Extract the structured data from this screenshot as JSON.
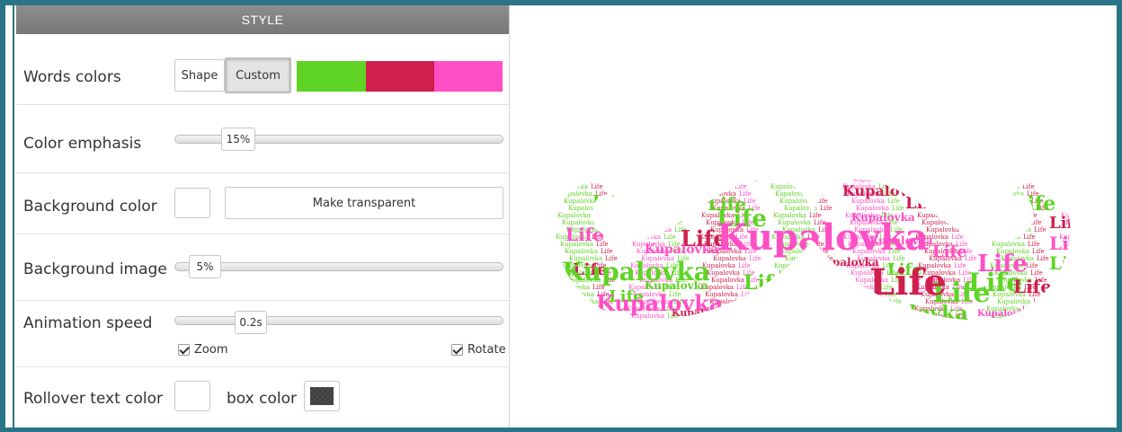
{
  "panel": {
    "header": "STYLE"
  },
  "words_colors": {
    "label": "Words colors",
    "shape_btn": "Shape",
    "custom_btn": "Custom",
    "swatches": [
      "#5fd425",
      "#cf1f4d",
      "#ff4fc6"
    ]
  },
  "color_emphasis": {
    "label": "Color emphasis",
    "value": "15%",
    "fraction": 0.15
  },
  "background_color": {
    "label": "Background color",
    "transparent_btn": "Make transparent",
    "color": "#ffffff"
  },
  "background_image": {
    "label": "Background image",
    "value": "5%",
    "fraction": 0.05
  },
  "animation_speed": {
    "label": "Animation speed",
    "value": "0.2s",
    "fraction": 0.19,
    "zoom_label": "Zoom",
    "rotate_label": "Rotate",
    "zoom_checked": true,
    "rotate_checked": true
  },
  "rollover": {
    "label": "Rollover text color",
    "box_label": "box color",
    "text_color": "#ffffff",
    "box_color": "#3f3f3f"
  },
  "word_cloud": {
    "shape": "mustache-icon",
    "words": [
      "Kupalovka",
      "Life"
    ],
    "colors": [
      "#5fd425",
      "#cf1f4d",
      "#ff4fc6"
    ]
  }
}
